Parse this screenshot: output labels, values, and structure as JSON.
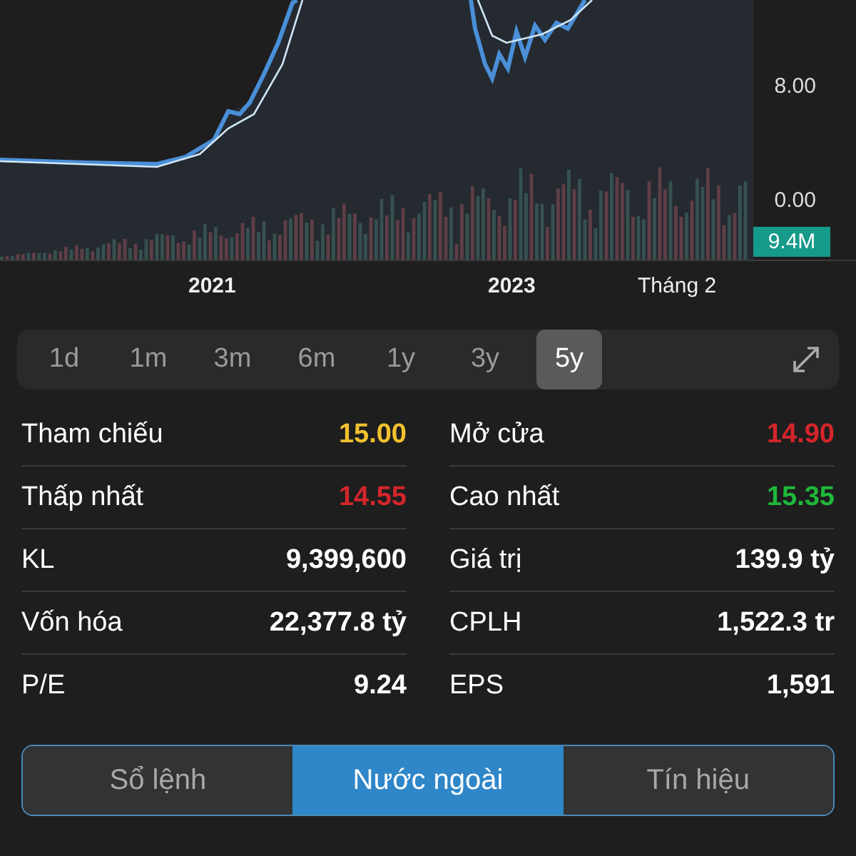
{
  "chart": {
    "y_labels": [
      "8.00",
      "0.00"
    ],
    "volume_badge": "9.4M",
    "x_labels": [
      "2021",
      "2023",
      "Tháng 2"
    ]
  },
  "ranges": [
    {
      "label": "1d",
      "selected": false
    },
    {
      "label": "1m",
      "selected": false
    },
    {
      "label": "3m",
      "selected": false
    },
    {
      "label": "6m",
      "selected": false
    },
    {
      "label": "1y",
      "selected": false
    },
    {
      "label": "3y",
      "selected": false
    },
    {
      "label": "5y",
      "selected": true
    }
  ],
  "stats": [
    {
      "label": "Tham chiếu",
      "value": "15.00",
      "color": "#f2c12e"
    },
    {
      "label": "Mở cửa",
      "value": "14.90",
      "color": "#d4262b"
    },
    {
      "label": "Thấp nhất",
      "value": "14.55",
      "color": "#d4262b"
    },
    {
      "label": "Cao nhất",
      "value": "15.35",
      "color": "#1fb83a"
    },
    {
      "label": "KL",
      "value": "9,399,600",
      "color": "#ffffff"
    },
    {
      "label": "Giá trị",
      "value": "139.9 tỷ",
      "color": "#ffffff"
    },
    {
      "label": "Vốn hóa",
      "value": "22,377.8 tỷ",
      "color": "#ffffff"
    },
    {
      "label": "CPLH",
      "value": "1,522.3 tr",
      "color": "#ffffff"
    },
    {
      "label": "P/E",
      "value": "9.24",
      "color": "#ffffff"
    },
    {
      "label": "EPS",
      "value": "1,591",
      "color": "#ffffff"
    }
  ],
  "tabs": [
    {
      "label": "Sổ lệnh",
      "selected": false
    },
    {
      "label": "Nước ngoài",
      "selected": true
    },
    {
      "label": "Tín hiệu",
      "selected": false
    }
  ]
}
